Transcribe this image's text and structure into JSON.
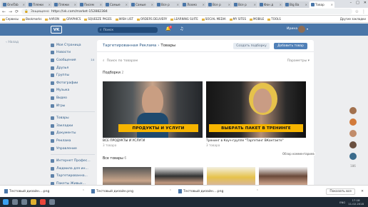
{
  "browser": {
    "tabs": [
      "OneTab",
      "Пляжи",
      "Пляжи",
      "Писем",
      "Самые",
      "Самые",
      "Все р",
      "Лохмо",
      "Все р",
      "Все р",
      "Фон д",
      "Big Ba",
      "Товар"
    ],
    "address": {
      "secure_label": "Защищено",
      "url": "https://vk.com/market-152882384"
    },
    "bookmarks": [
      "Сервисы",
      "Bookmarks",
      "AARON",
      "GRAPHICS",
      "SQUEEZE PAGES",
      "WISH LIST",
      "ORDERS DELIVERY",
      "LEARNING SUITE",
      "SOCIAL MEDIA",
      "MY SITES",
      "MOBILE",
      "TOOLS"
    ],
    "bookmarks_other": "Другие закладки"
  },
  "vk": {
    "logo": "VK",
    "search_placeholder": "Поиск",
    "notif_count": "7",
    "user_name": "Ирина"
  },
  "left": {
    "back_label": "Назад"
  },
  "sidebar": {
    "items": [
      {
        "label": "Моя Страница",
        "count": ""
      },
      {
        "label": "Новости",
        "count": ""
      },
      {
        "label": "Сообщения",
        "count": "14"
      },
      {
        "label": "Друзья",
        "count": ""
      },
      {
        "label": "Группы",
        "count": ""
      },
      {
        "label": "Фотографии",
        "count": ""
      },
      {
        "label": "Музыка",
        "count": ""
      },
      {
        "label": "Видео",
        "count": ""
      },
      {
        "label": "Игры",
        "count": ""
      }
    ],
    "items2": [
      {
        "label": "Товары"
      },
      {
        "label": "Закладки"
      },
      {
        "label": "Документы"
      },
      {
        "label": "Реклама"
      },
      {
        "label": "Управление"
      }
    ],
    "items3": [
      {
        "label": "Интернет Профес..."
      },
      {
        "label": "Людмила для ин..."
      },
      {
        "label": "Таргетированна..."
      },
      {
        "label": "Пакеты Живых..."
      }
    ]
  },
  "page": {
    "breadcrumb_parent": "Таргетированная Реклама",
    "breadcrumb_sep": "›",
    "breadcrumb_current": "Товары",
    "create_album_btn": "Создать подборку",
    "add_product_btn": "Добавить товар",
    "search_placeholder": "Поиск по товарам",
    "params_label": "Параметры",
    "collections_title": "Подборки",
    "collections_count": "2",
    "collections": [
      {
        "banner": "ПРОДУКТЫ И УСЛУГИ",
        "title": "ВСЕ ПРОДУКТЫ И УСЛУГИ",
        "sub": "3 товара"
      },
      {
        "banner": "ВЫБРАТЬ ПАКЕТ В ТРЕНИНГЕ",
        "title": "Тренинг в Коуч-группе \"Таргетинг ВКонтакте\"",
        "sub": "3 товара"
      }
    ],
    "all_title": "Все товары",
    "all_count": "6",
    "tooltip": "Обзор комментариев"
  },
  "right": {
    "count": "186"
  },
  "downloads": {
    "files": [
      "Тестовый дизайн....png",
      "Тестовый дизайн.png",
      "Тестовый дизайн....png"
    ],
    "show_all": "Показать все"
  },
  "taskbar": {
    "lang": "ENG",
    "time": "17:18",
    "date": "11.02.2018"
  }
}
